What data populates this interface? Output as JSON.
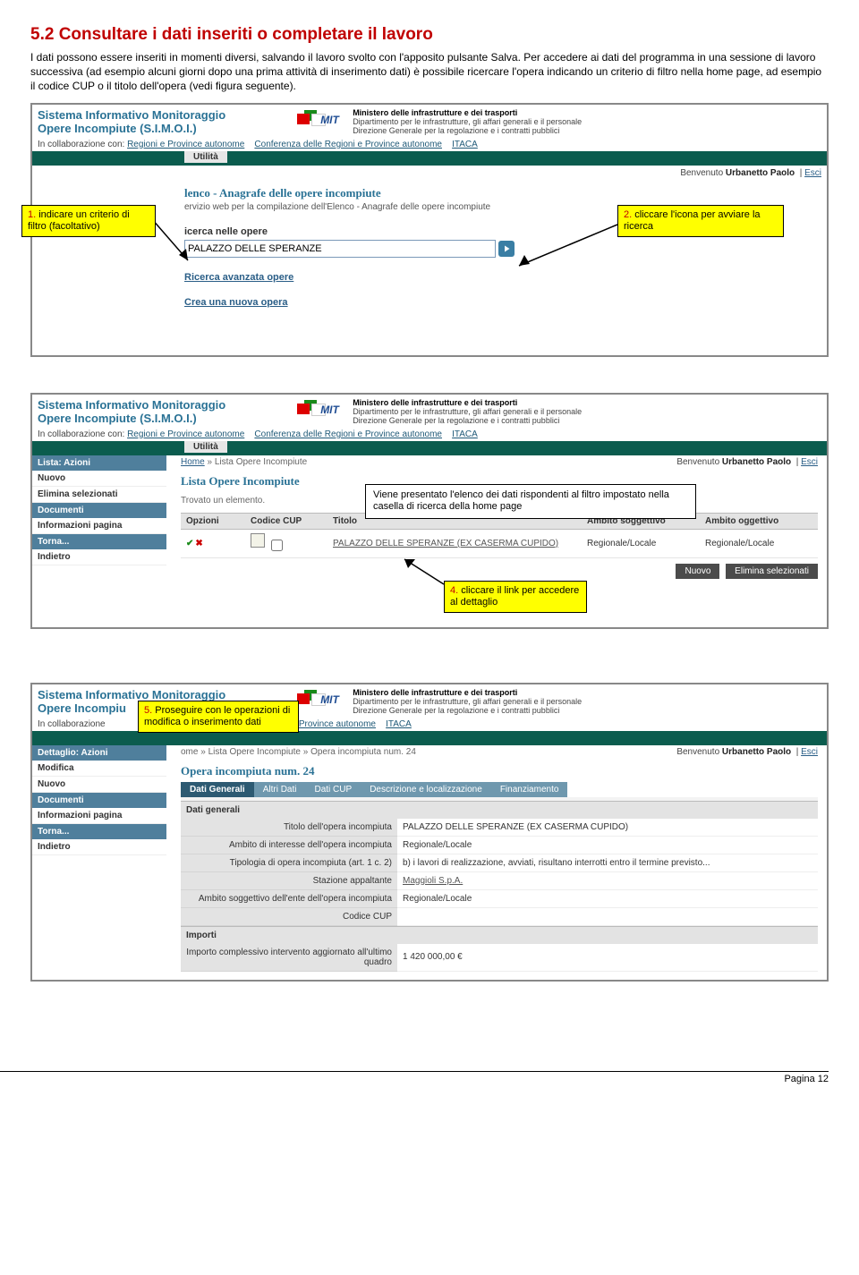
{
  "doc": {
    "heading": "5.2   Consultare i dati inseriti o completare il lavoro",
    "para": "I dati possono essere inseriti in momenti diversi, salvando il lavoro svolto con l'apposito pulsante Salva. Per accedere ai dati del programma in una sessione di lavoro successiva (ad esempio alcuni giorni dopo una prima attività di inserimento dati) è possibile ricercare l'opera indicando un criterio di filtro nella home page, ad esempio il codice CUP o il titolo dell'opera (vedi figura seguente).",
    "footer": "Pagina 12"
  },
  "common": {
    "app_title_l1": "Sistema Informativo Monitoraggio",
    "app_title_l2": "Opere Incompiute (S.I.M.O.I.)",
    "mit_l1": "Ministero delle infrastrutture e dei trasporti",
    "mit_l2": "Dipartimento per le infrastrutture, gli affari generali e il personale",
    "mit_l3": "Direzione Generale per la regolazione e i contratti pubblici",
    "collab_prefix": "In collaborazione con:",
    "collab_a1": "Regioni e Province autonome",
    "collab_a2": "Conferenza delle Regioni e Province autonome",
    "collab_a3": "ITACA",
    "utilita": "Utilità",
    "welcome": "Benvenuto",
    "user": "Urbanetto Paolo",
    "esci": "Esci"
  },
  "shot1": {
    "title": "lenco - Anagrafe delle opere incompiute",
    "desc": "ervizio web per la compilazione dell'Elenco - Anagrafe delle opere incompiute",
    "search_label": "icerca nelle opere",
    "search_value": "PALAZZO DELLE SPERANZE",
    "adv": "Ricerca avanzata opere",
    "create": "Crea una nuova opera",
    "callout1": "indicare un criterio di filtro (facoltativo)",
    "callout2": "cliccare l'icona per avviare la ricerca"
  },
  "shot2": {
    "crumb_home": "Home",
    "crumb_cur": "Lista Opere Incompiute",
    "title": "Lista Opere Incompiute",
    "found": "Trovato un elemento.",
    "th_opzioni": "Opzioni",
    "th_cup": "Codice CUP",
    "th_titolo": "Titolo",
    "th_sogg": "Ambito soggettivo",
    "th_ogg": "Ambito oggettivo",
    "row_titolo": "PALAZZO DELLE SPERANZE (EX CASERMA CUPIDO)",
    "row_sogg": "Regionale/Locale",
    "row_ogg": "Regionale/Locale",
    "btn_nuovo": "Nuovo",
    "btn_elimina": "Elimina selezionati",
    "sb_hdr1": "Lista: Azioni",
    "sb_i1": "Nuovo",
    "sb_i2": "Elimina selezionati",
    "sb_hdr2": "Documenti",
    "sb_i3": "Informazioni pagina",
    "sb_hdr3": "Torna...",
    "sb_i4": "Indietro",
    "callout_white": "Viene presentato l'elenco dei dati rispondenti al filtro impostato nella casella di ricerca della home page",
    "callout4": "cliccare il link per accedere al dettaglio"
  },
  "shot3": {
    "crumb": "ome » Lista Opere Incompiute » Opera incompiuta num. 24",
    "title": "Opera incompiuta num. 24",
    "tab1": "Dati Generali",
    "tab2": "Altri Dati",
    "tab3": "Dati CUP",
    "tab4": "Descrizione e localizzazione",
    "tab5": "Finanziamento",
    "subhdr1": "Dati generali",
    "r1l": "Titolo dell'opera incompiuta",
    "r1v": "PALAZZO DELLE SPERANZE (EX CASERMA CUPIDO)",
    "r2l": "Ambito di interesse dell'opera incompiuta",
    "r2v": "Regionale/Locale",
    "r3l": "Tipologia di opera incompiuta (art. 1 c. 2)",
    "r3v": "b) i lavori di realizzazione, avviati, risultano interrotti entro il termine previsto...",
    "r4l": "Stazione appaltante",
    "r4v": "Maggioli S.p.A.",
    "r5l": "Ambito soggettivo dell'ente dell'opera incompiuta",
    "r5v": "Regionale/Locale",
    "r6l": "Codice CUP",
    "subhdr2": "Importi",
    "r7l": "Importo complessivo intervento aggiornato all'ultimo quadro",
    "r7v": "1 420 000,00 €",
    "sb_hdr1": "Dettaglio: Azioni",
    "sb_i1": "Modifica",
    "sb_i2": "Nuovo",
    "sb_hdr2": "Documenti",
    "sb_i3": "Informazioni pagina",
    "sb_hdr3": "Torna...",
    "sb_i4": "Indietro",
    "callout5": "Proseguire con le operazioni di modifica o inserimento dati"
  }
}
